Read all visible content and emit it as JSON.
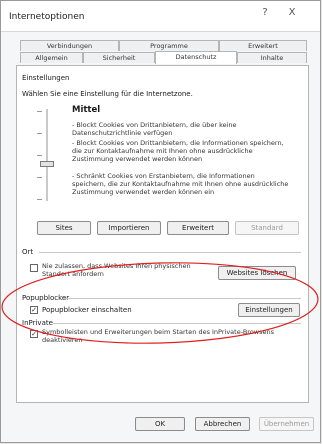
{
  "window": {
    "title": "Internetoptionen",
    "help_label": "?",
    "close_label": "X"
  },
  "tabs": {
    "row1": [
      "Verbindungen",
      "Programme",
      "Erweitert"
    ],
    "row2": [
      "Allgemein",
      "Sicherheit",
      "Datenschutz",
      "Inhalte"
    ],
    "active": "Datenschutz"
  },
  "settings": {
    "heading": "Einstellungen",
    "prompt": "Wählen Sie eine Einstellung für die Internetzone.",
    "level": "Mittel",
    "descriptions": [
      "- Blockt Cookies von Drittanbietern, die über keine Datenschutzrichtlinie verfügen",
      "- Blockt Cookies von Drittanbietern, die Informationen speichern, die zur Kontaktaufnahme mit Ihnen ohne ausdrückliche Zustimmung verwendet werden können",
      "- Schränkt Cookies von Erstanbietern, die Informationen speichern, die zur Kontaktaufnahme mit Ihnen ohne ausdrückliche Zustimmung verwendet werden können ein"
    ],
    "buttons": {
      "sites": "Sites",
      "import": "Importieren",
      "advanced": "Erweitert",
      "default": "Standard"
    }
  },
  "location": {
    "heading": "Ort",
    "checkbox_label": "Nie zulassen, dass Websites Ihren physischen Standort anfordern",
    "clear_button": "Websites löschen"
  },
  "popup": {
    "heading": "Popupblocker",
    "checkbox_label": "Popupblocker einschalten",
    "checked": true,
    "settings_button": "Einstellungen"
  },
  "inprivate": {
    "heading": "InPrivate",
    "checkbox_label": "Symbolleisten und Erweiterungen beim Starten des InPrivate-Browsens deaktivieren",
    "checked": true
  },
  "footer": {
    "ok": "OK",
    "cancel": "Abbrechen",
    "apply": "Übernehmen"
  },
  "highlight_color": "#e02020"
}
